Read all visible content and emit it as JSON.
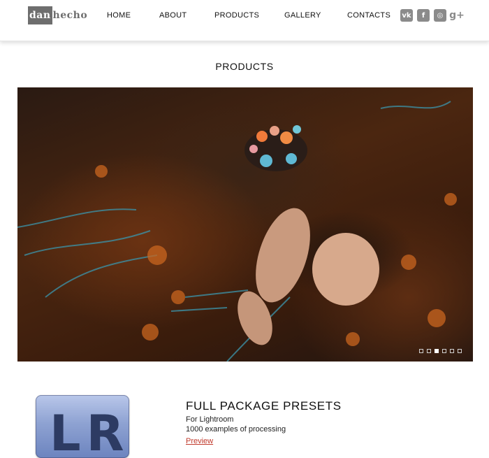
{
  "header": {
    "logo": {
      "part1": "dan",
      "part2": "hecho"
    },
    "nav": [
      {
        "label": "HOME"
      },
      {
        "label": "ABOUT"
      },
      {
        "label": "PRODUCTS"
      },
      {
        "label": "GALLERY"
      },
      {
        "label": "CONTACTS"
      }
    ],
    "social": [
      {
        "icon": "vk-icon",
        "glyph": "vk"
      },
      {
        "icon": "facebook-icon",
        "glyph": "f"
      },
      {
        "icon": "instagram-icon",
        "glyph": "◎"
      },
      {
        "icon": "google-plus-icon",
        "glyph": "g+"
      }
    ]
  },
  "page": {
    "title": "PRODUCTS"
  },
  "slider": {
    "slide_count": 6,
    "active_index": 2
  },
  "product": {
    "thumb_text": "LR",
    "title": "FULL PACKAGE PRESETS",
    "subtitle": "For Lightroom",
    "description": "1000 examples of processing",
    "link": "Preview"
  },
  "colors": {
    "logo_gray": "#6e6e6e",
    "icon_gray": "#8b8b8b",
    "link_red": "#c0392b",
    "lr_blue": "#8ea2d2"
  }
}
